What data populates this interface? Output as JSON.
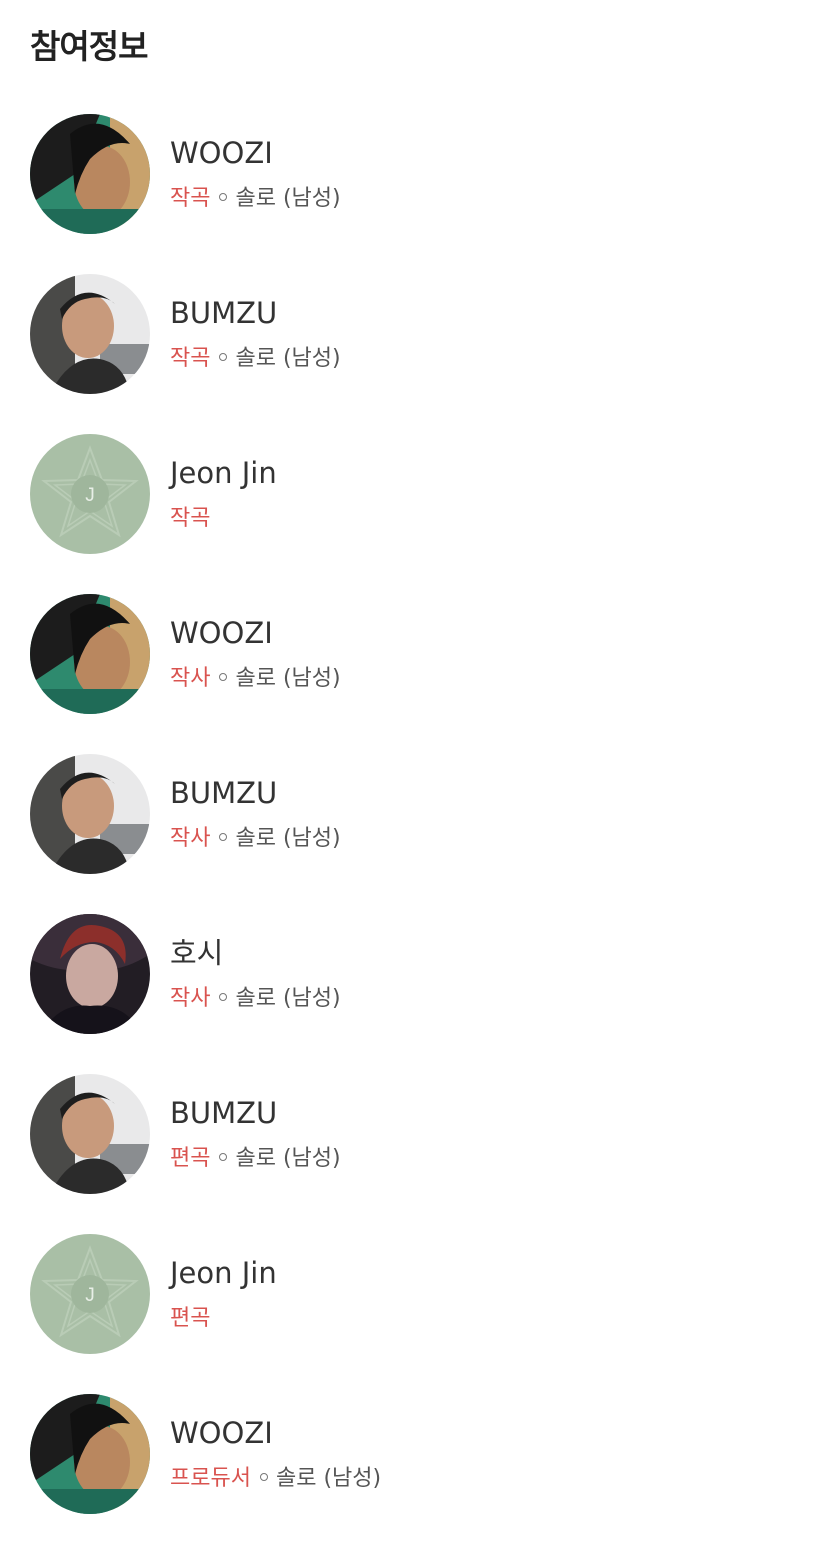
{
  "section": {
    "title": "참여정보"
  },
  "credits": [
    {
      "name": "WOOZI",
      "role": "작곡",
      "type": "솔로 (남성)",
      "avatar": "photo-woozi"
    },
    {
      "name": "BUMZU",
      "role": "작곡",
      "type": "솔로 (남성)",
      "avatar": "photo-bumzu"
    },
    {
      "name": "Jeon Jin",
      "role": "작곡",
      "type": "",
      "avatar": "placeholder",
      "avatar_initial": "J"
    },
    {
      "name": "WOOZI",
      "role": "작사",
      "type": "솔로 (남성)",
      "avatar": "photo-woozi"
    },
    {
      "name": "BUMZU",
      "role": "작사",
      "type": "솔로 (남성)",
      "avatar": "photo-bumzu"
    },
    {
      "name": "호시",
      "role": "작사",
      "type": "솔로 (남성)",
      "avatar": "photo-hoshi"
    },
    {
      "name": "BUMZU",
      "role": "편곡",
      "type": "솔로 (남성)",
      "avatar": "photo-bumzu"
    },
    {
      "name": "Jeon Jin",
      "role": "편곡",
      "type": "",
      "avatar": "placeholder",
      "avatar_initial": "J"
    },
    {
      "name": "WOOZI",
      "role": "프로듀서",
      "type": "솔로 (남성)",
      "avatar": "photo-woozi"
    }
  ],
  "colors": {
    "role": "#d9534f",
    "placeholder_bg": "#a9bfa6"
  }
}
